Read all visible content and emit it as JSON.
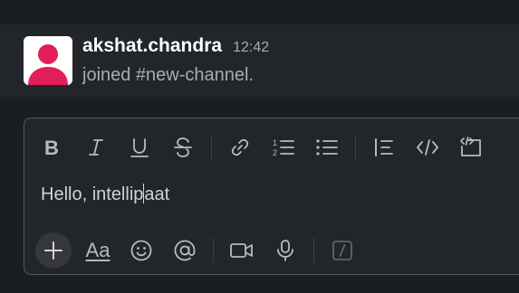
{
  "message": {
    "username": "akshat.chandra",
    "timestamp": "12:42",
    "text": "joined #new-channel.",
    "avatar_icon": "user-silhouette-icon",
    "avatar_color": "#e01e5a"
  },
  "composer": {
    "text_before_caret": "Hello, intellip",
    "text_after_caret": "aat",
    "format_toolbar": [
      {
        "name": "bold-icon"
      },
      {
        "name": "italic-icon"
      },
      {
        "name": "underline-icon"
      },
      {
        "name": "strikethrough-icon"
      },
      {
        "name": "link-icon"
      },
      {
        "name": "ordered-list-icon"
      },
      {
        "name": "bulleted-list-icon"
      },
      {
        "name": "blockquote-icon"
      },
      {
        "name": "code-icon"
      },
      {
        "name": "code-block-icon"
      }
    ],
    "bottom_toolbar": {
      "text_format_label": "Aa",
      "icons": [
        "plus-icon",
        "emoji-icon",
        "mention-icon",
        "video-icon",
        "microphone-icon",
        "shortcut-icon"
      ]
    }
  },
  "colors": {
    "background": "#1a1d21",
    "message_bg": "#222529",
    "avatar_pink": "#e01e5a",
    "icon_gray": "#b9babd"
  }
}
